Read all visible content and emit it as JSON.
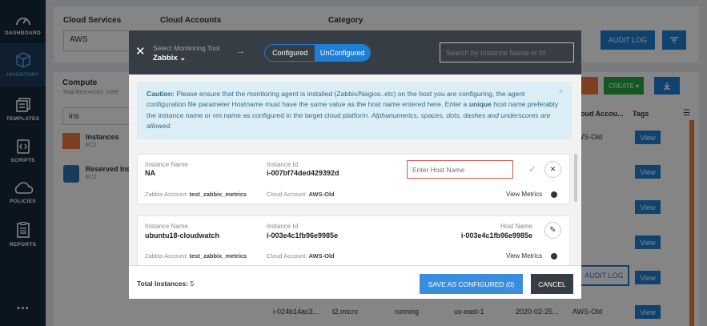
{
  "sidebar": {
    "items": [
      {
        "id": "dashboard",
        "label": "DASHBOARD",
        "icon": "gauge-icon"
      },
      {
        "id": "inventory",
        "label": "INVENTORY",
        "icon": "cube-icon"
      },
      {
        "id": "templates",
        "label": "TEMPLATES",
        "icon": "template-icon"
      },
      {
        "id": "scripts",
        "label": "SCRIPTS",
        "icon": "script-icon"
      },
      {
        "id": "policies",
        "label": "POLICIES",
        "icon": "cloud-icon"
      },
      {
        "id": "reports",
        "label": "REPORTS",
        "icon": "report-icon"
      }
    ],
    "more": "..."
  },
  "background": {
    "cloud_services_label": "Cloud Services",
    "cloud_services_value": "AWS",
    "cloud_accounts_label": "Cloud Accounts",
    "category_label": "Category",
    "audit_log": "AUDIT LOG",
    "compute_title": "Compute",
    "total_resources": "Total Resources: 1699",
    "search_value": "ins",
    "instances_label": "Instances",
    "instances_sub": "EC2",
    "reserved_label": "Reserved Inst",
    "reserved_sub": "EC2",
    "create_label": "CREATE ▾",
    "cloud_account_col": "Cloud Accou...",
    "tags_col": "Tags",
    "row_account": "AWS-Old",
    "view_label": "View",
    "audit_log2": "AUDIT LOG",
    "bottom_row": {
      "id": "i-024b14ac3...",
      "type": "t2.micro",
      "state": "running",
      "region": "us-east-1",
      "date": "2020-02-25...",
      "account": "AWS-Old",
      "view": "View"
    }
  },
  "modal": {
    "select_tool_label": "Select Monitoring Tool",
    "tool": "Zabbix",
    "toggle_configured": "Configured",
    "toggle_unconfigured": "UnConfigured",
    "search_placeholder": "Search by Instance Name or Id",
    "caution": {
      "label": "Caution:",
      "text1": " Please ensure that the monitoring agent is installed (Zabbix/Nagios..etc) on the host you are configuring, the agent configuration file parameter Hostname must have the same value as the host name entered here. Enter a ",
      "unique": "unique",
      "text2": " host name preferably the instance name or vm name as configured in the target cloud platform. ",
      "italic": "Alphanumerics, spaces, dots, dashes and underscores are allowed."
    },
    "cards": [
      {
        "instance_name_label": "Instance Name",
        "instance_name": "NA",
        "instance_id_label": "Instance Id",
        "instance_id": "i-007bf74ded429392d",
        "host_placeholder": "Enter Host Name",
        "zabbix_label": "Zabbix Account:",
        "zabbix_value": "test_zabbix_metrics",
        "cloud_label": "Cloud Account:",
        "cloud_value": "AWS-Old",
        "view_metrics": "View Metrics"
      },
      {
        "instance_name_label": "Instance Name",
        "instance_name": "ubuntu18-cloudwatch",
        "instance_id_label": "Instance Id",
        "instance_id": "i-003e4c1fb96e9985e",
        "host_name_label": "Host Name",
        "host_name": "i-003e4c1fb96e9985e",
        "zabbix_label": "Zabbix Account:",
        "zabbix_value": "test_zabbix_metrics",
        "cloud_label": "Cloud Account:",
        "cloud_value": "AWS-Old",
        "view_metrics": "View Metrics"
      }
    ],
    "total_label": "Total Instances:",
    "total_value": "5",
    "save_button": "SAVE AS CONFIGURED (0)",
    "cancel_button": "CANCEL"
  },
  "colors": {
    "sidebar": "#16293e",
    "accent": "#1f7fd6",
    "header": "#373d44",
    "caution_bg": "#dbeef6",
    "orange": "#f0793d",
    "error_border": "#d9534f"
  }
}
